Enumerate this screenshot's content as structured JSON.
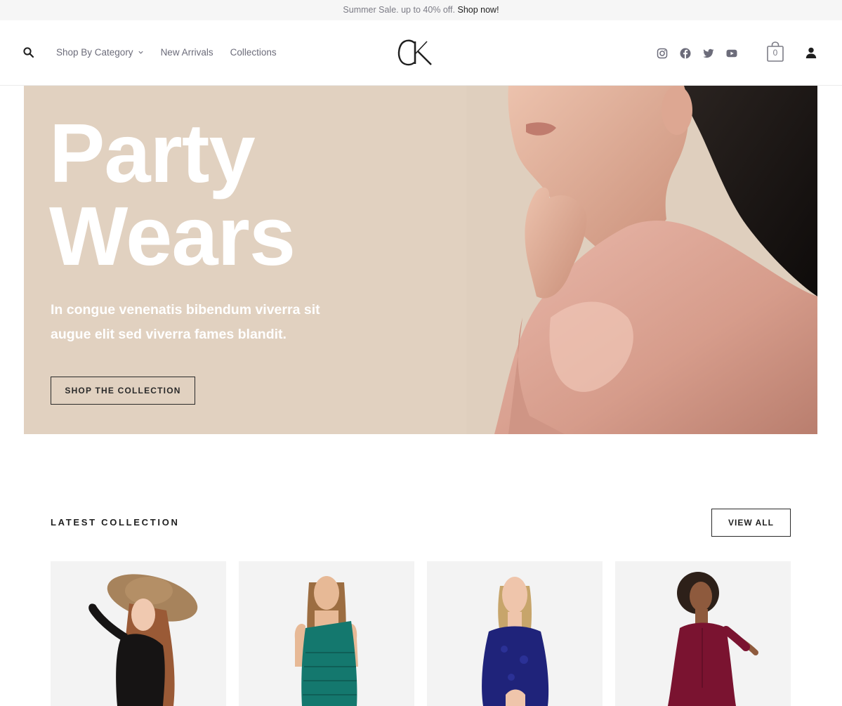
{
  "announcement": {
    "text": "Summer Sale. up to 40% off.",
    "link_text": "Shop now!"
  },
  "header": {
    "logo_text": "CK",
    "nav": [
      {
        "label": "Shop By Category",
        "has_dropdown": true
      },
      {
        "label": "New Arrivals",
        "has_dropdown": false
      },
      {
        "label": "Collections",
        "has_dropdown": false
      }
    ],
    "socials": [
      "instagram-icon",
      "facebook-icon",
      "twitter-icon",
      "youtube-icon"
    ],
    "cart_count": "0",
    "icons": {
      "search": "search-icon",
      "cart": "shopping-bag-icon",
      "account": "user-icon"
    }
  },
  "hero": {
    "title_line1": "Party",
    "title_line2": "Wears",
    "subtitle": "In congue venenatis bibendum viverra sit augue elit sed viverra fames blandit.",
    "button_label": "SHOP THE COLLECTION",
    "background_color": "#e1d1c0",
    "image": "woman-in-pink-blouse-photo"
  },
  "latest": {
    "title": "LATEST COLLECTION",
    "view_all_label": "VIEW ALL",
    "products": [
      {
        "image": "woman-black-top-wide-brim-hat"
      },
      {
        "image": "woman-teal-fringe-one-shoulder-dress"
      },
      {
        "image": "woman-navy-lace-bodysuit"
      },
      {
        "image": "woman-burgundy-button-dress"
      }
    ]
  },
  "colors": {
    "text": "#1f1f1f",
    "muted": "#7c7c86",
    "hero_bg": "#e1d1c0",
    "card_bg": "#f3f3f3"
  }
}
